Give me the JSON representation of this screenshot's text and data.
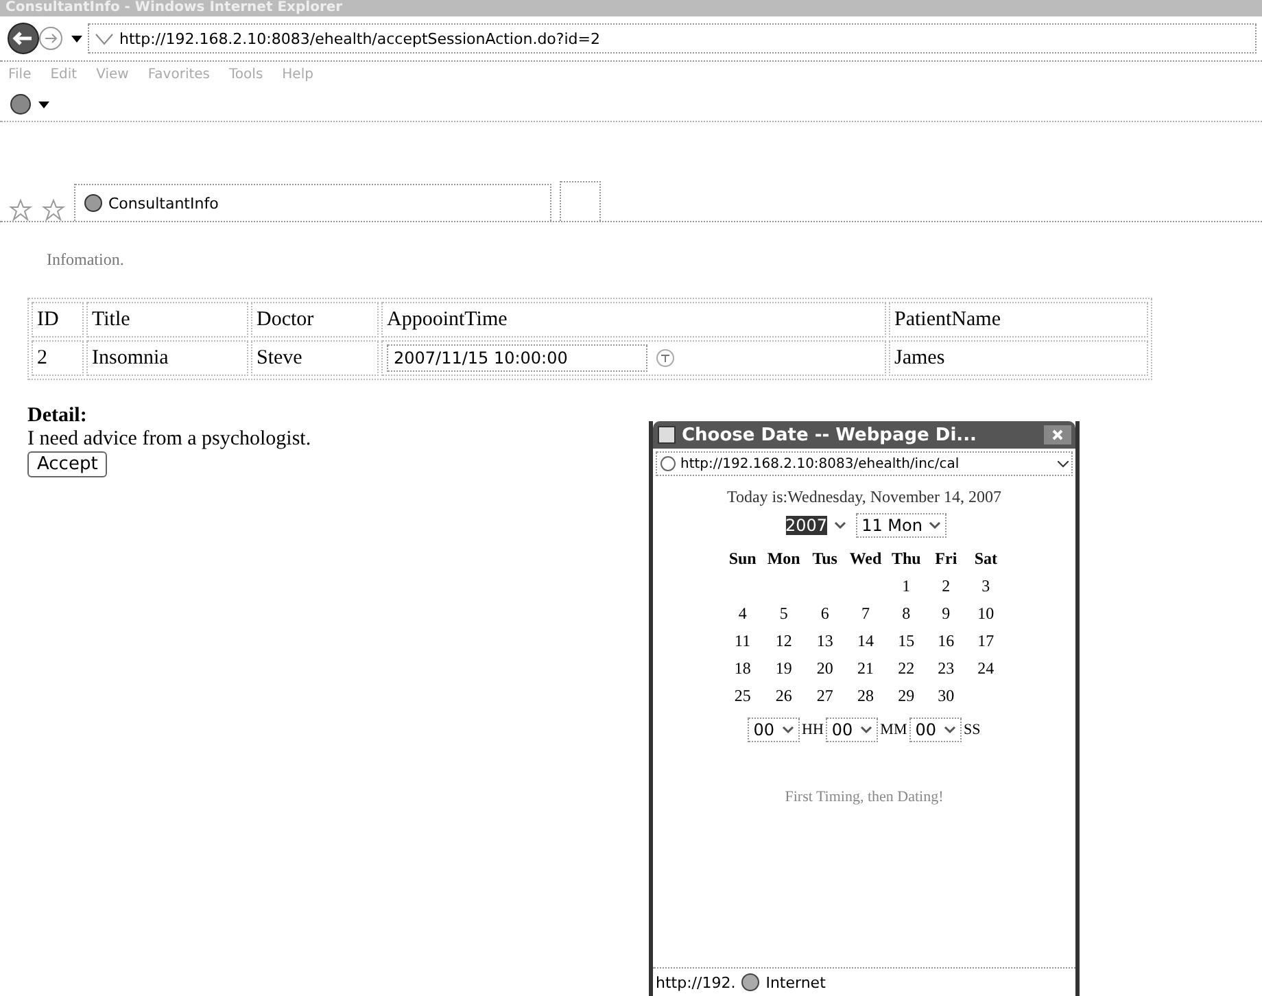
{
  "window": {
    "title": "ConsultantInfo - Windows Internet Explorer",
    "address": "http://192.168.2.10:8083/ehealth/acceptSessionAction.do?id=2"
  },
  "menu": [
    "File",
    "Edit",
    "View",
    "Favorites",
    "Tools",
    "Help"
  ],
  "tab": {
    "label": "ConsultantInfo"
  },
  "page": {
    "heading": "Infomation.",
    "table": {
      "columns": [
        "ID",
        "Title",
        "Doctor",
        "AppoointTime",
        "PatientName"
      ],
      "rows": [
        {
          "id": "2",
          "title": "Insomnia",
          "doctor": "Steve",
          "time": "2007/11/15 10:00:00",
          "patient": "James"
        }
      ]
    },
    "detail_label": "Detail:",
    "detail_text": "I need advice from a psychologist.",
    "button": "Accept"
  },
  "dialog": {
    "title": "Choose Date -- Webpage Di...",
    "address": "http://192.168.2.10:8083/ehealth/inc/cal",
    "today": "Today is:Wednesday, November 14, 2007",
    "year": {
      "value": "2007",
      "highlighted": true
    },
    "month": {
      "value": "11 Mon"
    },
    "weekdays": [
      "Sun",
      "Mon",
      "Tus",
      "Wed",
      "Thu",
      "Fri",
      "Sat"
    ],
    "weeks": [
      [
        "1",
        "2",
        "3"
      ],
      [
        "4",
        "5",
        "6",
        "7",
        "8",
        "9",
        "10"
      ],
      [
        "11",
        "12",
        "13",
        "14",
        "15",
        "16",
        "17"
      ],
      [
        "18",
        "19",
        "20",
        "21",
        "22",
        "23",
        "24"
      ],
      [
        "25",
        "26",
        "27",
        "28",
        "29",
        "30"
      ]
    ],
    "time": [
      {
        "value": "00",
        "unit": "HH"
      },
      {
        "value": "00",
        "unit": "MM"
      },
      {
        "value": "00",
        "unit": "SS"
      }
    ],
    "hint": "First Timing, then Dating!",
    "status": "http://192.",
    "zone": "Internet"
  }
}
